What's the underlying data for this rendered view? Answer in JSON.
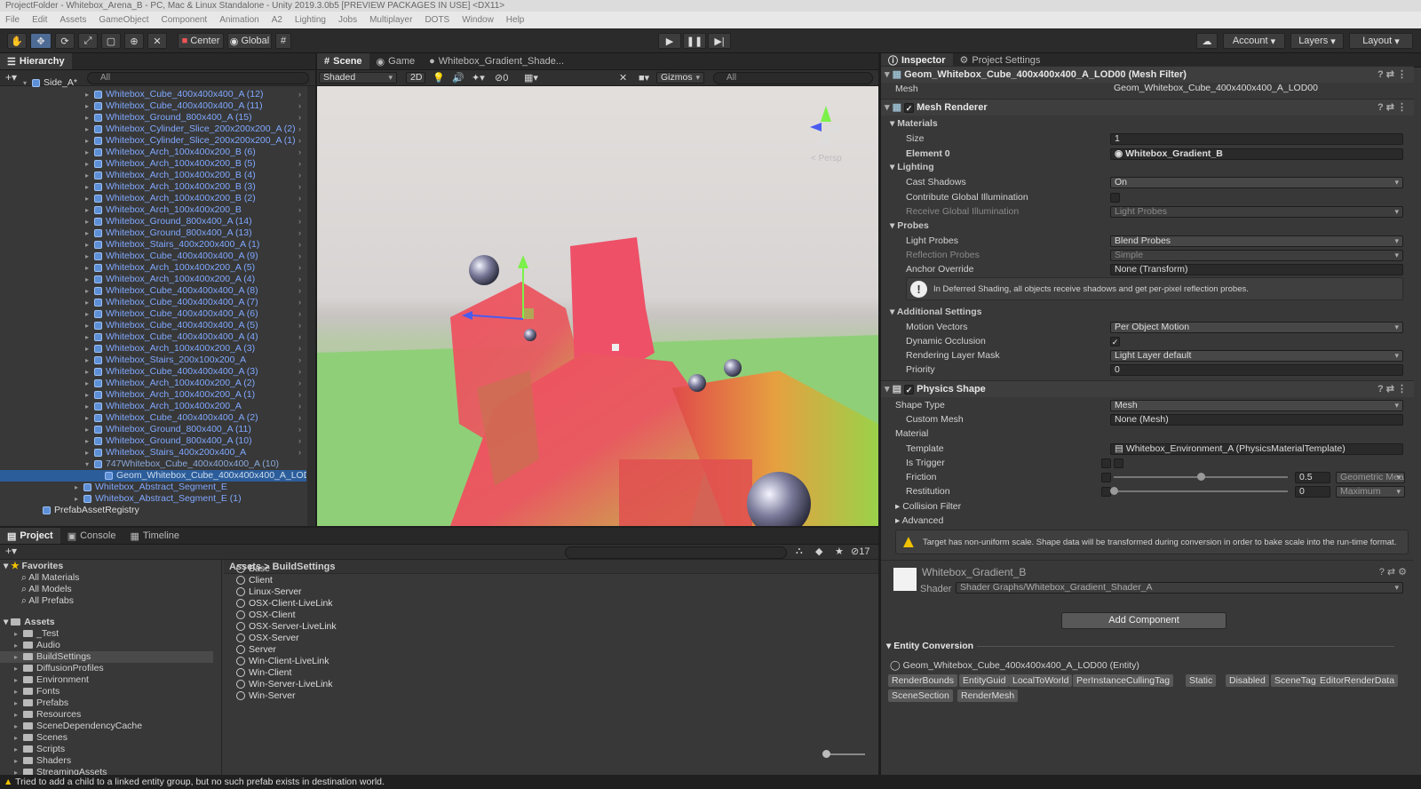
{
  "window": {
    "title": "ProjectFolder - Whitebox_Arena_B - PC, Mac & Linux Standalone - Unity 2019.3.0b5 [PREVIEW PACKAGES IN USE] <DX11>"
  },
  "menu": [
    "File",
    "Edit",
    "Assets",
    "GameObject",
    "Component",
    "Animation",
    "A2",
    "Lighting",
    "Jobs",
    "Multiplayer",
    "DOTS",
    "Window",
    "Help"
  ],
  "toolbar": {
    "pivot_label": "Center",
    "space_label": "Global",
    "account_label": "Account",
    "layers_label": "Layers",
    "layout_label": "Layout"
  },
  "hierarchy": {
    "tab": "Hierarchy",
    "search_placeholder": "All",
    "root": "Side_A*",
    "items": [
      "Whitebox_Cube_400x400x400_A (12)",
      "Whitebox_Cube_400x400x400_A (11)",
      "Whitebox_Ground_800x400_A (15)",
      "Whitebox_Cylinder_Slice_200x200x200_A (2)",
      "Whitebox_Cylinder_Slice_200x200x200_A (1)",
      "Whitebox_Arch_100x400x200_B (6)",
      "Whitebox_Arch_100x400x200_B (5)",
      "Whitebox_Arch_100x400x200_B (4)",
      "Whitebox_Arch_100x400x200_B (3)",
      "Whitebox_Arch_100x400x200_B (2)",
      "Whitebox_Arch_100x400x200_B",
      "Whitebox_Ground_800x400_A (14)",
      "Whitebox_Ground_800x400_A (13)",
      "Whitebox_Stairs_400x200x400_A (1)",
      "Whitebox_Cube_400x400x400_A (9)",
      "Whitebox_Arch_100x400x200_A (5)",
      "Whitebox_Arch_100x400x200_A (4)",
      "Whitebox_Cube_400x400x400_A (8)",
      "Whitebox_Cube_400x400x400_A (7)",
      "Whitebox_Cube_400x400x400_A (6)",
      "Whitebox_Cube_400x400x400_A (5)",
      "Whitebox_Cube_400x400x400_A (4)",
      "Whitebox_Arch_100x400x200_A (3)",
      "Whitebox_Stairs_200x100x200_A",
      "Whitebox_Cube_400x400x400_A (3)",
      "Whitebox_Arch_100x400x200_A (2)",
      "Whitebox_Arch_100x400x200_A (1)",
      "Whitebox_Arch_100x400x200_A",
      "Whitebox_Cube_400x400x400_A (2)",
      "Whitebox_Ground_800x400_A (11)",
      "Whitebox_Ground_800x400_A (10)",
      "Whitebox_Stairs_400x200x400_A"
    ],
    "parent_item": "747Whitebox_Cube_400x400x400_A (10)",
    "selected_item": "Geom_Whitebox_Cube_400x400x400_A_LOD",
    "tail_items": [
      "Whitebox_Abstract_Segment_E",
      "Whitebox_Abstract_Segment_E (1)"
    ],
    "registry": "PrefabAssetRegistry"
  },
  "scene": {
    "tabs": [
      "Scene",
      "Game",
      "Whitebox_Gradient_Shade..."
    ],
    "shading_mode": "Shaded",
    "mode_2d": "2D",
    "hidden_count": "0",
    "gizmos_label": "Gizmos",
    "search_placeholder": "All",
    "persp_label": "< Persp"
  },
  "inspector": {
    "tabs": [
      "Inspector",
      "Project Settings"
    ],
    "mesh_filter_title": "Geom_Whitebox_Cube_400x400x400_A_LOD00 (Mesh Filter)",
    "mesh_label": "Mesh",
    "mesh_value": "Geom_Whitebox_Cube_400x400x400_A_LOD00",
    "mesh_renderer_title": "Mesh Renderer",
    "materials_header": "Materials",
    "size_label": "Size",
    "size_value": "1",
    "element0_label": "Element 0",
    "element0_value": "Whitebox_Gradient_B",
    "lighting_header": "Lighting",
    "cast_shadows_label": "Cast Shadows",
    "cast_shadows_value": "On",
    "contrib_gi_label": "Contribute Global Illumination",
    "receive_gi_label": "Receive Global Illumination",
    "receive_gi_value": "Light Probes",
    "probes_header": "Probes",
    "light_probes_label": "Light Probes",
    "light_probes_value": "Blend Probes",
    "reflection_probes_label": "Reflection Probes",
    "reflection_probes_value": "Simple",
    "anchor_override_label": "Anchor Override",
    "anchor_override_value": "None (Transform)",
    "deferred_info": "In Deferred Shading, all objects receive shadows and get per-pixel reflection probes.",
    "additional_header": "Additional Settings",
    "motion_vectors_label": "Motion Vectors",
    "motion_vectors_value": "Per Object Motion",
    "dynamic_occlusion_label": "Dynamic Occlusion",
    "rendering_layer_label": "Rendering Layer Mask",
    "rendering_layer_value": "Light Layer default",
    "priority_label": "Priority",
    "priority_value": "0",
    "physics_shape_title": "Physics Shape",
    "shape_type_label": "Shape Type",
    "shape_type_value": "Mesh",
    "custom_mesh_label": "Custom Mesh",
    "custom_mesh_value": "None (Mesh)",
    "material_header": "Material",
    "template_label": "Template",
    "template_value": "Whitebox_Environment_A (PhysicsMaterialTemplate)",
    "is_trigger_label": "Is Trigger",
    "friction_label": "Friction",
    "friction_value": "0.5",
    "friction_level": 0.5,
    "friction_mode": "Geometric Mea",
    "restitution_label": "Restitution",
    "restitution_value": "0",
    "restitution_level": 0,
    "restitution_mode": "Maximum",
    "collision_filter_label": "Collision Filter",
    "advanced_label": "Advanced",
    "nonuniform_warning": "Target has non-uniform scale. Shape data will be transformed during conversion in order to bake scale into the run-time format.",
    "material_name": "Whitebox_Gradient_B",
    "shader_label": "Shader",
    "shader_value": "Shader Graphs/Whitebox_Gradient_Shader_A",
    "add_component_label": "Add Component",
    "entity_conversion_header": "Entity Conversion",
    "entity_name": "Geom_Whitebox_Cube_400x400x400_A_LOD00 (Entity)",
    "entity_tags": [
      "RenderBounds",
      "EntityGuid",
      "LocalToWorld",
      "PerInstanceCullingTag",
      "Static",
      "Disabled",
      "SceneTag",
      "EditorRenderData",
      "SceneSection",
      "RenderMesh"
    ]
  },
  "project": {
    "tabs": [
      "Project",
      "Console",
      "Timeline"
    ],
    "hidden_count": "17",
    "favorites_label": "Favorites",
    "favorites": [
      "All Materials",
      "All Models",
      "All Prefabs"
    ],
    "assets_label": "Assets",
    "folders": [
      "_Test",
      "Audio",
      "BuildSettings",
      "DiffusionProfiles",
      "Environment",
      "Fonts",
      "Prefabs",
      "Resources",
      "SceneDependencyCache",
      "Scenes",
      "Scripts",
      "Shaders",
      "StreamingAssets"
    ],
    "breadcrumb_root": "Assets",
    "breadcrumb_current": "BuildSettings",
    "assets": [
      "Base",
      "Client",
      "Linux-Server",
      "OSX-Client-LiveLink",
      "OSX-Client",
      "OSX-Server-LiveLink",
      "OSX-Server",
      "Server",
      "Win-Client-LiveLink",
      "Win-Client",
      "Win-Server-LiveLink",
      "Win-Server"
    ]
  },
  "status": {
    "message": "Tried to add a child to a linked entity group, but no such prefab exists in destination world."
  },
  "colors": {
    "accent_selection": "#2c5d9b",
    "prefab_text": "#7fa8ff",
    "warning_yellow": "#f2c200"
  }
}
